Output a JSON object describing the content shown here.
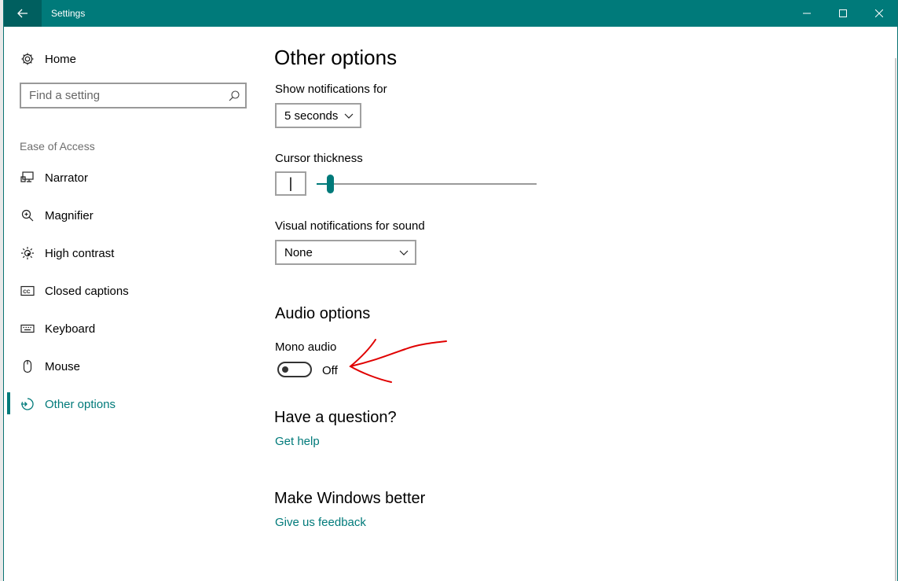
{
  "window": {
    "title": "Settings"
  },
  "sidebar": {
    "home_label": "Home",
    "search_placeholder": "Find a setting",
    "section_label": "Ease of Access",
    "items": [
      {
        "label": "Narrator",
        "icon": "narrator-icon"
      },
      {
        "label": "Magnifier",
        "icon": "magnifier-icon"
      },
      {
        "label": "High contrast",
        "icon": "high-contrast-icon"
      },
      {
        "label": "Closed captions",
        "icon": "closed-captions-icon"
      },
      {
        "label": "Keyboard",
        "icon": "keyboard-icon"
      },
      {
        "label": "Mouse",
        "icon": "mouse-icon"
      },
      {
        "label": "Other options",
        "icon": "other-options-icon",
        "active": true
      }
    ]
  },
  "main": {
    "title": "Other options",
    "notifications": {
      "label": "Show notifications for",
      "value": "5 seconds"
    },
    "cursor": {
      "label": "Cursor thickness",
      "preview": "|",
      "level": 0.06
    },
    "visual_notifications": {
      "label": "Visual notifications for sound",
      "value": "None"
    },
    "audio": {
      "section_title": "Audio options",
      "mono_label": "Mono audio",
      "mono_state": "Off"
    },
    "question": {
      "title": "Have a question?",
      "link": "Get help"
    },
    "feedback": {
      "title": "Make Windows better",
      "link": "Give us feedback"
    }
  },
  "colors": {
    "accent": "#007a7a",
    "annotation": "#e00000"
  }
}
